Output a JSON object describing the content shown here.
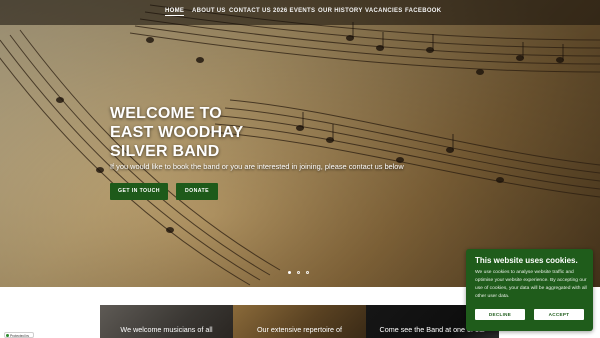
{
  "nav": {
    "items": [
      {
        "label": "HOME",
        "active": true
      },
      {
        "label": "ABOUT US",
        "active": false
      },
      {
        "label": "CONTACT US",
        "active": false
      },
      {
        "label": "2026 EVENTS",
        "active": false
      },
      {
        "label": "OUR HISTORY",
        "active": false
      },
      {
        "label": "VACANCIES",
        "active": false
      },
      {
        "label": "FACEBOOK",
        "active": false
      }
    ]
  },
  "hero": {
    "title_line1": "WELCOME TO",
    "title_line2": "EAST WOODHAY",
    "title_line3": "SILVER BAND",
    "subtitle": "If you would like to book the band or you are interested in joining, please contact us below",
    "button_contact": "GET IN TOUCH",
    "button_donate": "DONATE",
    "slide_count": 3,
    "active_slide": 1
  },
  "cards": [
    {
      "text": "We welcome musicians of all"
    },
    {
      "text": "Our extensive repertoire of"
    },
    {
      "text": "Come see the Band at one of our"
    }
  ],
  "cookie": {
    "title": "This website uses cookies.",
    "text": "We use cookies to analyse website traffic and optimise your website experience. By accepting our use of cookies, your data will be aggregated with all other user data.",
    "decline": "DECLINE",
    "accept": "ACCEPT"
  },
  "recaptcha_badge": "Protected by",
  "colors": {
    "brand_green": "#1e5a1a",
    "cookie_green": "#1f5c1b",
    "nav_overlay": "rgba(20,15,10,0.55)"
  }
}
